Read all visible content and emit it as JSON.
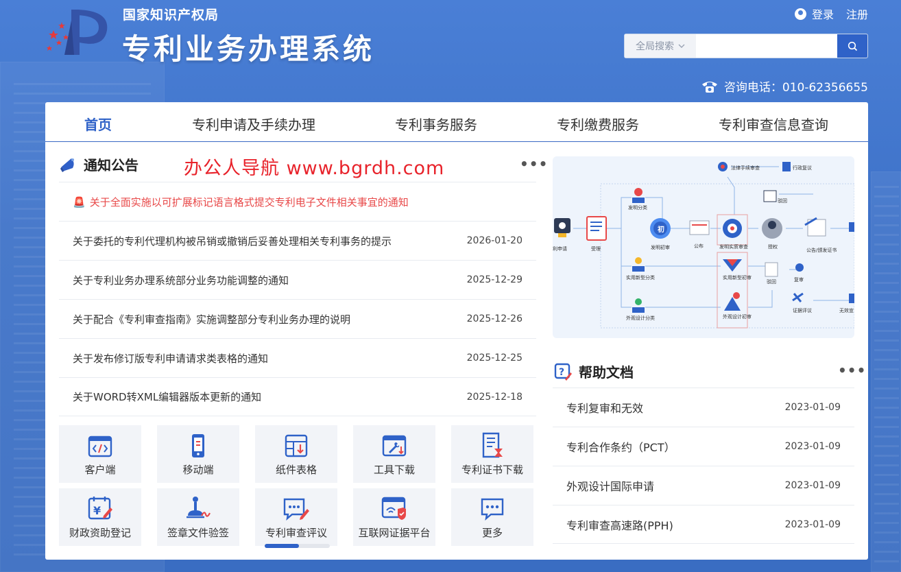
{
  "header": {
    "org_name": "国家知识产权局",
    "system_name": "专利业务办理系统",
    "login_label": "登录",
    "register_label": "注册",
    "search_scope": "全局搜索",
    "search_placeholder": "",
    "phone_label": "咨询电话：010-62356655"
  },
  "nav": {
    "tabs": [
      {
        "label": "首页",
        "active": true
      },
      {
        "label": "专利申请及手续办理"
      },
      {
        "label": "专利事务服务"
      },
      {
        "label": "专利缴费服务"
      },
      {
        "label": "专利审查信息查询"
      }
    ]
  },
  "notices": {
    "title": "通知公告",
    "watermark": "办公人导航  www.bgrdh.com",
    "more_label": "•••",
    "items": [
      {
        "text": "关于全面实施以可扩展标记语言格式提交专利电子文件相关事宜的通知",
        "date": ""
      },
      {
        "text": "关于委托的专利代理机构被吊销或撤销后妥善处理相关专利事务的提示",
        "date": "2026-01-20"
      },
      {
        "text": "关于专利业务办理系统部分业务功能调整的通知",
        "date": "2025-12-29"
      },
      {
        "text": "关于配合《专利审查指南》实施调整部分专利业务办理的说明",
        "date": "2025-12-26"
      },
      {
        "text": "关于发布修订版专利申请请求类表格的通知",
        "date": "2025-12-25"
      },
      {
        "text": "关于WORD转XML编辑器版本更新的通知",
        "date": "2025-12-18"
      }
    ]
  },
  "quick_links": [
    {
      "label": "客户端",
      "icon": "code-window-icon"
    },
    {
      "label": "移动端",
      "icon": "mobile-icon"
    },
    {
      "label": "纸件表格",
      "icon": "table-download-icon"
    },
    {
      "label": "工具下载",
      "icon": "tool-download-icon"
    },
    {
      "label": "专利证书下载",
      "icon": "certificate-icon"
    },
    {
      "label": "财政资助登记",
      "icon": "finance-calendar-icon"
    },
    {
      "label": "签章文件验签",
      "icon": "stamp-icon"
    },
    {
      "label": "专利审查评议",
      "icon": "comment-edit-icon"
    },
    {
      "label": "互联网证据平台",
      "icon": "evidence-icon"
    },
    {
      "label": "更多",
      "icon": "more-chat-icon"
    }
  ],
  "quick_links_scroll": 0.53,
  "diagram": {
    "labels": [
      "利申请",
      "受理",
      "发明分类",
      "初",
      "发明初审",
      "公布",
      "发明实质审查",
      "授权",
      "公告/颁发证书",
      "法律手续审查",
      "行政复议",
      "驳回",
      "实用新型分类",
      "实用新型初审",
      "驳回",
      "复审",
      "外观设计分类",
      "外观设计初审",
      "证据评议",
      "无效宣"
    ]
  },
  "help": {
    "title": "帮助文档",
    "more_label": "•••",
    "items": [
      {
        "text": "专利复审和无效",
        "date": "2023-01-09"
      },
      {
        "text": "专利合作条约（PCT）",
        "date": "2023-01-09"
      },
      {
        "text": "外观设计国际申请",
        "date": "2023-01-09"
      },
      {
        "text": "专利审查高速路(PPH)",
        "date": "2023-01-09"
      }
    ]
  },
  "colors": {
    "primary": "#2f62c8",
    "alert": "#e84848",
    "watermark": "#e8232b"
  }
}
